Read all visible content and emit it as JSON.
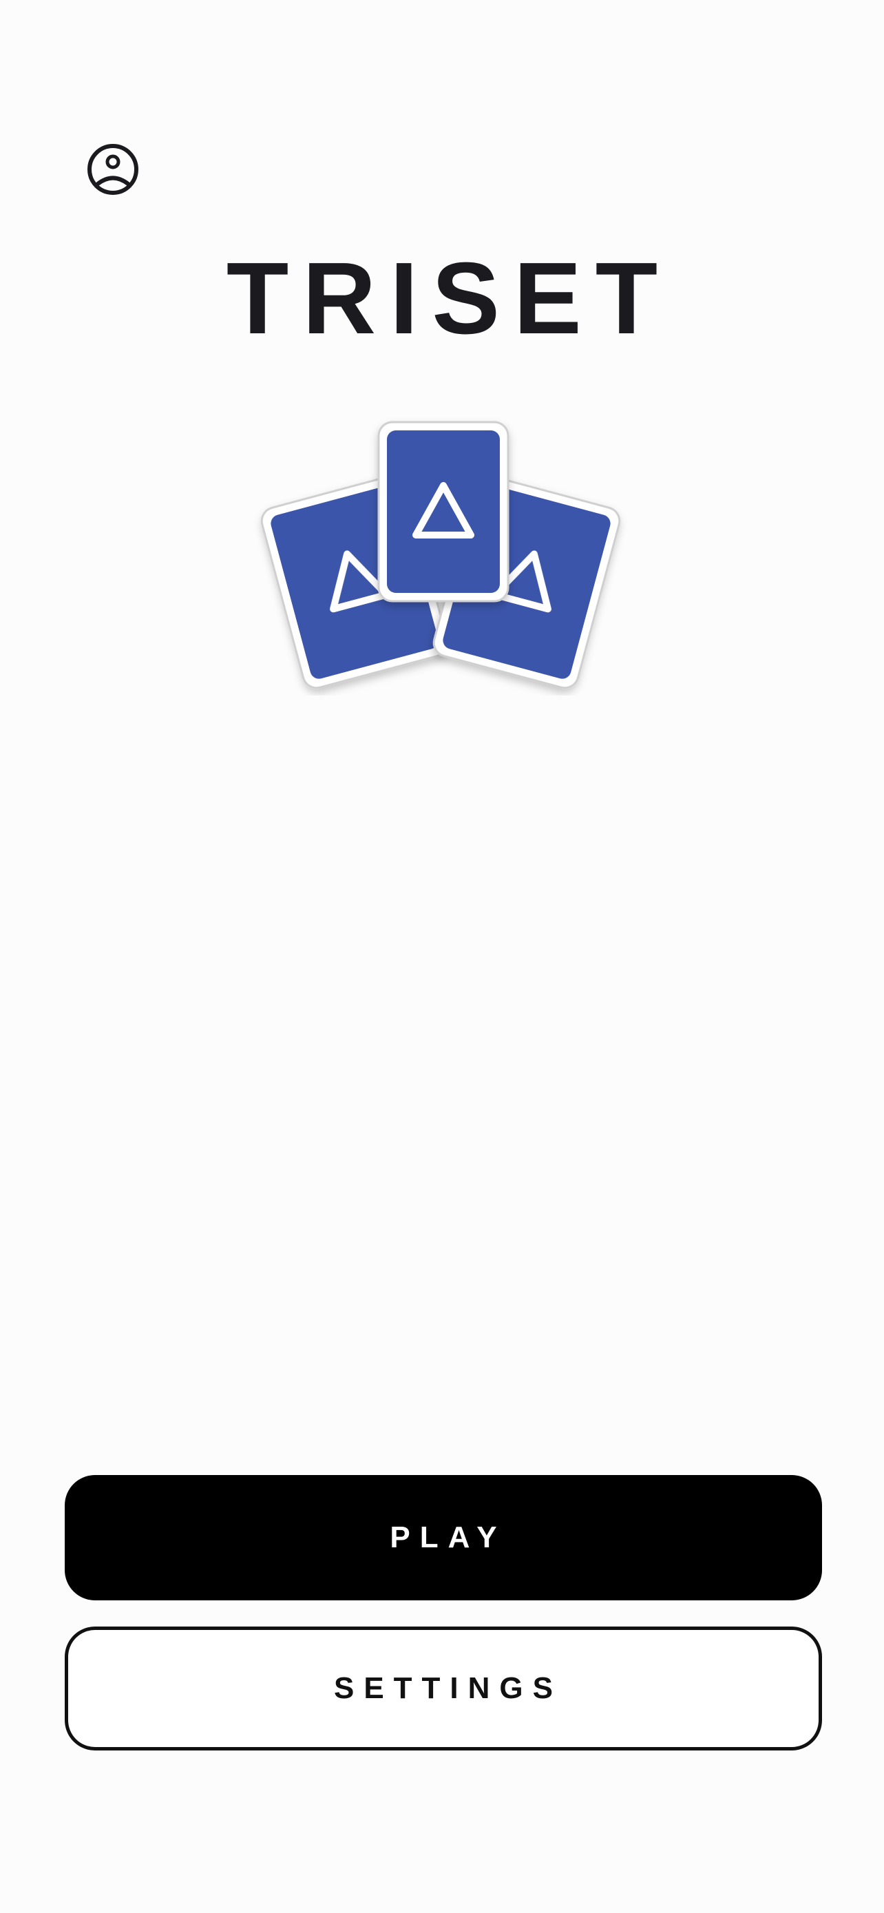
{
  "header": {
    "profile_icon": "user-circle-icon"
  },
  "app": {
    "title": "TRISET"
  },
  "logo": {
    "icon": "triangle-cards-logo",
    "card_color": "#3b55aa"
  },
  "actions": {
    "play_label": "PLAY",
    "settings_label": "SETTINGS"
  },
  "colors": {
    "background": "#fcfcfc",
    "text": "#1b1a1f",
    "primary_button": "#000000"
  }
}
